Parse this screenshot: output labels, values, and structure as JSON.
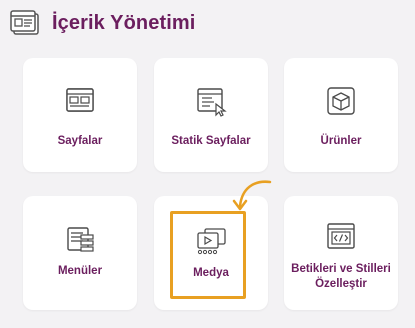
{
  "header": {
    "title": "İçerik Yönetimi",
    "icon": "content-management-icon"
  },
  "cards": [
    {
      "label": "Sayfalar",
      "icon": "pages-icon"
    },
    {
      "label": "Statik Sayfalar",
      "icon": "static-pages-icon"
    },
    {
      "label": "Ürünler",
      "icon": "products-icon"
    },
    {
      "label": "Menüler",
      "icon": "menus-icon"
    },
    {
      "label": "Medya",
      "icon": "media-icon"
    },
    {
      "label_line1": "Betikleri ve Stilleri",
      "label_line2": "Özelleştir",
      "icon": "scripts-styles-icon"
    }
  ],
  "annotation": {
    "highlighted_card": "Medya",
    "color": "#e8a022"
  },
  "colors": {
    "brand": "#6b1e5e",
    "background": "#f3f2f4",
    "card": "#ffffff",
    "icon_stroke": "#4a4a4a"
  }
}
